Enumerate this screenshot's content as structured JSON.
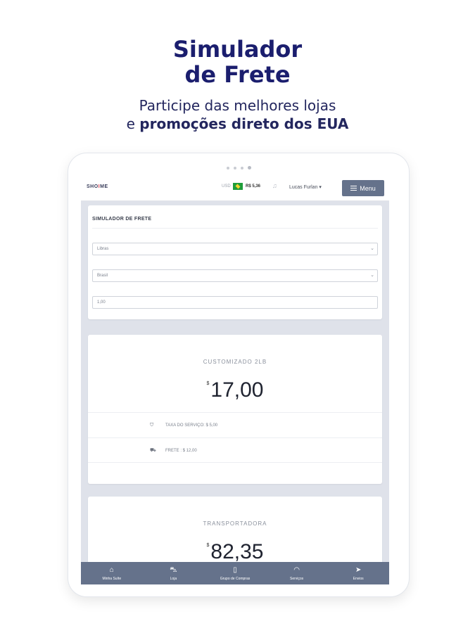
{
  "promo": {
    "title_line1": "Simulador",
    "title_line2": "de Frete",
    "sub_line1": "Participe das melhores lojas",
    "sub_line2_prefix": "e ",
    "sub_line2_strong": "promoções direto dos EUA"
  },
  "topbar": {
    "logo_prefix": "SHO",
    "logo_accent": "I",
    "logo_suffix": "ME",
    "currency": "USD",
    "rate": "R$ 5,36",
    "user": "Lucas Furlan ▾",
    "menu_label": "Menu"
  },
  "form": {
    "title": "SIMULADOR DE FRETE",
    "unit_value": "Libras",
    "country_value": "Brasil",
    "weight_value": "1,00"
  },
  "results": [
    {
      "title": "CUSTOMIZADO 2LB",
      "currency_symbol": "$",
      "price": "17,00",
      "service_fee": "TAXA DO SERVIÇO: $ 5,00",
      "freight": "FRETE : $ 12,00"
    },
    {
      "title": "TRANSPORTADORA",
      "currency_symbol": "$",
      "price": "82,35"
    }
  ],
  "bottom_nav": [
    {
      "label": "Minha Suíte",
      "icon": "bag-icon"
    },
    {
      "label": "Loja",
      "icon": "cart-icon"
    },
    {
      "label": "Grupo de Compras",
      "icon": "clipboard-icon"
    },
    {
      "label": "Serviços",
      "icon": "headset-icon"
    },
    {
      "label": "Envios",
      "icon": "send-icon"
    }
  ],
  "colors": {
    "title": "#1b1e6e",
    "nav_background": "#65728b",
    "screen_background": "#dfe2ea"
  }
}
